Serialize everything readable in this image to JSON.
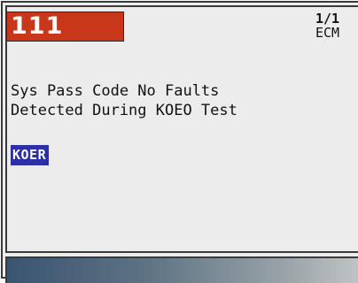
{
  "header": {
    "code": "111",
    "page_indicator": "1/1",
    "module": "ECM"
  },
  "message": {
    "lines": [
      "Sys Pass Code No Faults",
      "Detected During KOEO Test"
    ]
  },
  "menu": {
    "selected_item": "KOER"
  },
  "colors": {
    "code_background": "#c9371b",
    "selection_background": "#2d2fa6",
    "panel_background": "#ececec"
  }
}
